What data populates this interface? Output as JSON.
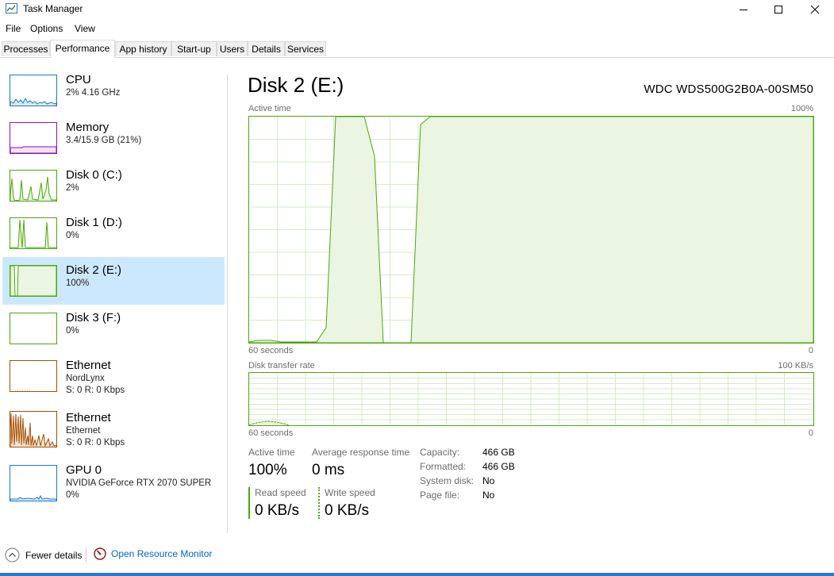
{
  "window": {
    "title": "Task Manager"
  },
  "menu": [
    "File",
    "Options",
    "View"
  ],
  "tabs": [
    "Processes",
    "Performance",
    "App history",
    "Start-up",
    "Users",
    "Details",
    "Services"
  ],
  "sidebar": [
    {
      "name": "CPU",
      "sub1": "2% 4.16 GHz",
      "color": "#1979c9"
    },
    {
      "name": "Memory",
      "sub1": "3.4/15.9 GB (21%)",
      "color": "#8b12ae"
    },
    {
      "name": "Disk 0 (C:)",
      "sub1": "2%",
      "color": "#4da60c"
    },
    {
      "name": "Disk 1 (D:)",
      "sub1": "0%",
      "color": "#4da60c"
    },
    {
      "name": "Disk 2 (E:)",
      "sub1": "100%",
      "color": "#4da60c",
      "selected": true
    },
    {
      "name": "Disk 3 (F:)",
      "sub1": "0%",
      "color": "#4da60c"
    },
    {
      "name": "Ethernet",
      "sub1": "NordLynx",
      "sub2": "S: 0 R: 0 Kbps",
      "color": "#a74f01"
    },
    {
      "name": "Ethernet",
      "sub1": "Ethernet",
      "sub2": "S: 0 R: 0 Kbps",
      "color": "#a74f01"
    },
    {
      "name": "GPU 0",
      "sub1": "NVIDIA GeForce RTX 2070 SUPER",
      "sub2": "0%",
      "color": "#1979c9"
    }
  ],
  "main": {
    "title": "Disk 2 (E:)",
    "model": "WDC  WDS500G2B0A-00SM50",
    "graph1": {
      "label": "Active time",
      "max": "100%",
      "time": "60 seconds",
      "min": "0"
    },
    "graph2": {
      "label": "Disk transfer rate",
      "max": "100 KB/s",
      "time": "60 seconds",
      "min": "0"
    },
    "stats": {
      "active_time_label": "Active time",
      "active_time": "100%",
      "avg_resp_label": "Average response time",
      "avg_resp": "0 ms",
      "read_label": "Read speed",
      "read": "0 KB/s",
      "write_label": "Write speed",
      "write": "0 KB/s"
    },
    "props": [
      {
        "k": "Capacity:",
        "v": "466 GB"
      },
      {
        "k": "Formatted:",
        "v": "466 GB"
      },
      {
        "k": "System disk:",
        "v": "No"
      },
      {
        "k": "Page file:",
        "v": "No"
      }
    ]
  },
  "footer": {
    "fewer": "Fewer details",
    "monitor": "Open Resource Monitor"
  },
  "colors": {
    "disk": "#4da60c",
    "disk_fill": "#eaf5e2",
    "link": "#0066cc",
    "selected": "#cce8ff"
  }
}
